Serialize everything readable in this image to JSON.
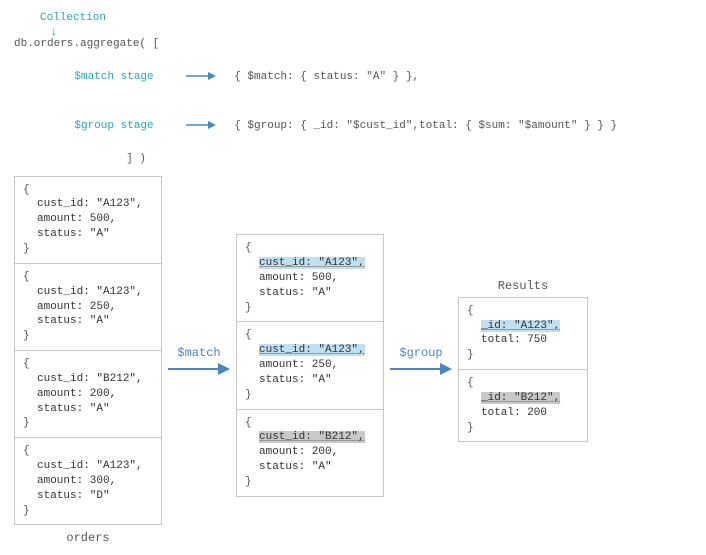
{
  "header": {
    "collection_label": "Collection",
    "aggregate_call_prefix": "db.orders.aggregate( [",
    "match_anno": "$match stage",
    "group_anno": "$group stage",
    "match_line": "{ $match: { status: \"A\" } },",
    "group_line": "{ $group: { _id: \"$cust_id\",total: { $sum: \"$amount\" } } }",
    "close_line": "] )"
  },
  "flow": {
    "match_label": "$match",
    "group_label": "$group"
  },
  "orders_label": "orders",
  "results_label": "Results",
  "orders": [
    {
      "cust_id": "cust_id: \"A123\",",
      "amount": "amount: 500,",
      "status": "status: \"A\""
    },
    {
      "cust_id": "cust_id: \"A123\",",
      "amount": "amount: 250,",
      "status": "status: \"A\""
    },
    {
      "cust_id": "cust_id: \"B212\",",
      "amount": "amount: 200,",
      "status": "status: \"A\""
    },
    {
      "cust_id": "cust_id: \"A123\",",
      "amount": "amount: 300,",
      "status": "status: \"D\""
    }
  ],
  "matched": [
    {
      "cust_id": "cust_id: \"A123\",",
      "amount": "amount: 500,",
      "status": "status: \"A\"",
      "hl": "blue"
    },
    {
      "cust_id": "cust_id: \"A123\",",
      "amount": "amount: 250,",
      "status": "status: \"A\"",
      "hl": "blue"
    },
    {
      "cust_id": "cust_id: \"B212\",",
      "amount": "amount: 200,",
      "status": "status: \"A\"",
      "hl": "gray"
    }
  ],
  "results": [
    {
      "id": "_id: \"A123\",",
      "total": "total: 750",
      "hl": "blue"
    },
    {
      "id": "_id: \"B212\",",
      "total": "total: 200",
      "hl": "gray"
    }
  ]
}
